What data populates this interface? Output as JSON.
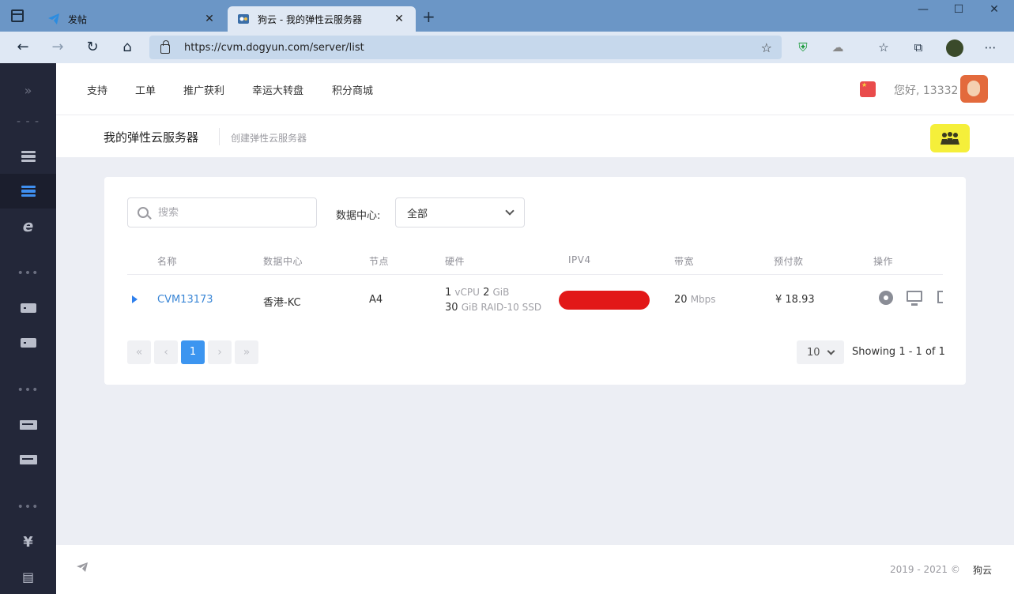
{
  "browser": {
    "tabs": [
      {
        "title": "发帖",
        "favicon": "telegram-icon"
      },
      {
        "title": "狗云 - 我的弹性云服务器",
        "favicon": "dogyun-icon"
      }
    ],
    "url": "https://cvm.dogyun.com/server/list",
    "window_controls": [
      "—",
      "☐",
      "✕"
    ]
  },
  "topnav": {
    "links": [
      "支持",
      "工单",
      "推广获利",
      "幸运大转盘",
      "积分商城"
    ],
    "greeting": "您好, 13332"
  },
  "subheader": {
    "title": "我的弹性云服务器",
    "create_link": "创建弹性云服务器"
  },
  "filters": {
    "search_placeholder": "搜索",
    "datacenter_label": "数据中心:",
    "datacenter_value": "全部"
  },
  "table": {
    "columns": [
      "名称",
      "数据中心",
      "节点",
      "硬件",
      "IPV4",
      "带宽",
      "预付款",
      "操作"
    ],
    "rows": [
      {
        "name": "CVM13173",
        "datacenter": "香港-KC",
        "node": "A4",
        "cpu_count": "1",
        "cpu_unit": "vCPU",
        "ram": "2",
        "ram_unit": "GiB",
        "disk": "30",
        "disk_unit": "GiB RAID-10 SSD",
        "bandwidth": "20",
        "bandwidth_unit": "Mbps",
        "prepaid": "¥ 18.93"
      }
    ]
  },
  "pagination": {
    "current_page": "1",
    "per_page": "10",
    "showing": "Showing 1 - 1 of 1"
  },
  "footer": {
    "copyright": "2019 - 2021 ©",
    "brand": "狗云"
  },
  "colors": {
    "sidebar_bg": "#232739",
    "accent_blue": "#3c95f0",
    "link_blue": "#3a86d6",
    "highlight_yellow": "#f5ef3a"
  }
}
